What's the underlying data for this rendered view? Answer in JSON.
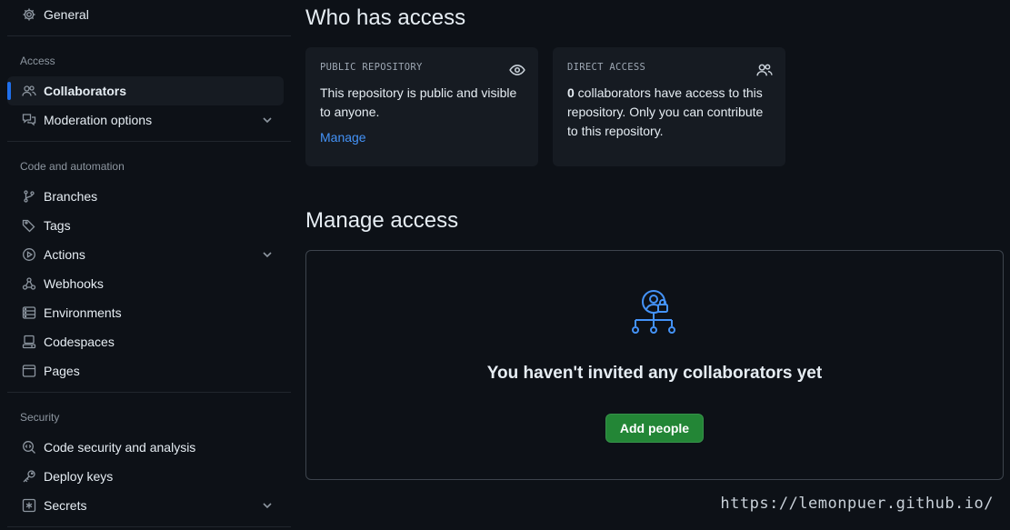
{
  "sidebar": {
    "general": "General",
    "sections": {
      "access": "Access",
      "code_automation": "Code and automation",
      "security": "Security"
    },
    "access_items": {
      "collaborators": "Collaborators",
      "moderation": "Moderation options"
    },
    "code_items": {
      "branches": "Branches",
      "tags": "Tags",
      "actions": "Actions",
      "webhooks": "Webhooks",
      "environments": "Environments",
      "codespaces": "Codespaces",
      "pages": "Pages"
    },
    "security_items": {
      "code_security": "Code security and analysis",
      "deploy_keys": "Deploy keys",
      "secrets": "Secrets"
    }
  },
  "main": {
    "who_title": "Who has access",
    "public_card": {
      "label": "PUBLIC REPOSITORY",
      "text": "This repository is public and visible to anyone.",
      "link": "Manage",
      "icon": "eye-icon"
    },
    "direct_card": {
      "label": "DIRECT ACCESS",
      "count": "0",
      "text": " collaborators have access to this repository. Only you can contribute to this repository.",
      "icon": "people-icon"
    },
    "manage_title": "Manage access",
    "blank": {
      "title": "You haven't invited any collaborators yet",
      "button": "Add people",
      "icon": "person-lock-network-icon"
    }
  },
  "watermark": "https://lemonpuer.github.io/",
  "colors": {
    "background": "#0d1117",
    "accent": "#1f6feb",
    "link": "#4493f8",
    "primary_button": "#238636"
  }
}
